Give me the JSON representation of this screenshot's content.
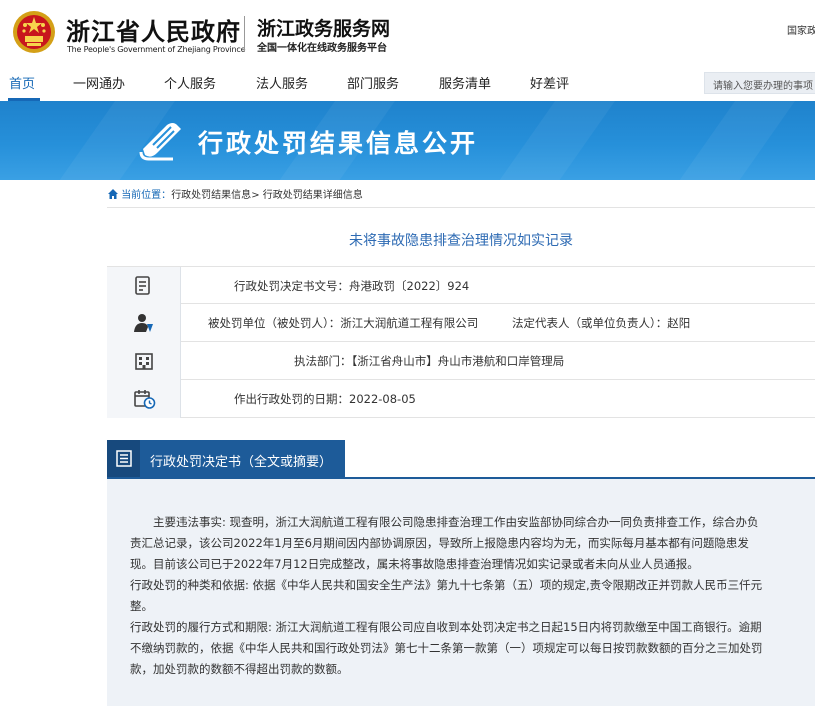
{
  "header": {
    "gov_name": "浙江省人民政府",
    "gov_name_en": "The People's Government of Zhejiang Province",
    "service_name": "浙江政务服务网",
    "service_sub": "全国一体化在线政务服务平台",
    "top_link": "国家政"
  },
  "nav": {
    "items": [
      {
        "label": "首页"
      },
      {
        "label": "一网通办"
      },
      {
        "label": "个人服务"
      },
      {
        "label": "法人服务"
      },
      {
        "label": "部门服务"
      },
      {
        "label": "服务清单"
      },
      {
        "label": "好差评"
      }
    ],
    "search_placeholder": "请输入您要办理的事项"
  },
  "banner": {
    "title": "行政处罚结果信息公开"
  },
  "breadcrumb": {
    "prefix": "当前位置：",
    "item1": "行政处罚结果信息",
    "sep": "> ",
    "item2": "行政处罚结果详细信息"
  },
  "page_title": "未将事故隐患排查治理情况如实记录",
  "info": {
    "doc_no": "行政处罚决定书文号：舟港政罚〔2022〕924",
    "party": "被处罚单位（被处罚人）：浙江大润航道工程有限公司",
    "legal_rep": "法定代表人（或单位负责人）：赵阳",
    "dept": "执法部门：【浙江省舟山市】舟山市港航和口岸管理局",
    "date": "作出行政处罚的日期：2022-08-05"
  },
  "section": {
    "title": "行政处罚决定书（全文或摘要）"
  },
  "body": {
    "lines": [
      "主要违法事实: 现查明，浙江大润航道工程有限公司隐患排查治理工作由安监部协同综合办一同负责排查工作，综合办负",
      "责汇总记录，该公司2022年1月至6月期间因内部协调原因，导致所上报隐患内容均为无，而实际每月基本都有问题隐患发",
      "现。目前该公司已于2022年7月12日完成整改，属未将事故隐患排查治理情况如实记录或者未向从业人员通报。",
      "行政处罚的种类和依据: 依据《中华人民共和国安全生产法》第九十七条第（五）项的规定,责令限期改正并罚款人民币三仟元",
      "整。",
      "行政处罚的履行方式和期限: 浙江大润航道工程有限公司应自收到本处罚决定书之日起15日内将罚款缴至中国工商银行。逾期",
      "不缴纳罚款的，依据《中华人民共和国行政处罚法》第七十二条第一款第（一）项规定可以每日按罚款数额的百分之三加处罚",
      "款，加处罚款的数额不得超出罚款的数额。"
    ]
  },
  "colors": {
    "accent": "#1668b6",
    "banner": "#2690da",
    "section": "#1d5b99",
    "title_blue": "#2d6ab3"
  }
}
